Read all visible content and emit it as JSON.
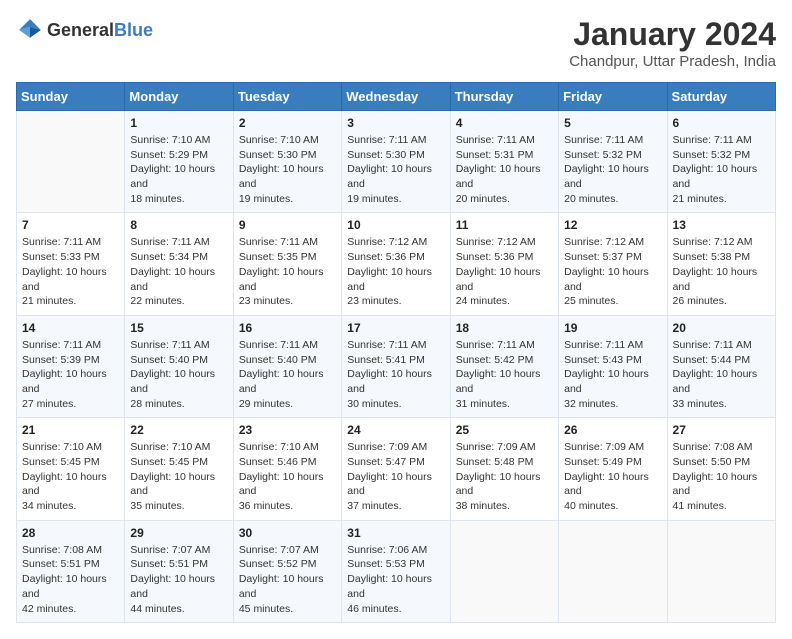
{
  "header": {
    "logo_general": "General",
    "logo_blue": "Blue",
    "title": "January 2024",
    "subtitle": "Chandpur, Uttar Pradesh, India"
  },
  "weekdays": [
    "Sunday",
    "Monday",
    "Tuesday",
    "Wednesday",
    "Thursday",
    "Friday",
    "Saturday"
  ],
  "weeks": [
    [
      {
        "day": "",
        "sunrise": "",
        "sunset": "",
        "daylight": ""
      },
      {
        "day": "1",
        "sunrise": "Sunrise: 7:10 AM",
        "sunset": "Sunset: 5:29 PM",
        "daylight": "Daylight: 10 hours and 18 minutes."
      },
      {
        "day": "2",
        "sunrise": "Sunrise: 7:10 AM",
        "sunset": "Sunset: 5:30 PM",
        "daylight": "Daylight: 10 hours and 19 minutes."
      },
      {
        "day": "3",
        "sunrise": "Sunrise: 7:11 AM",
        "sunset": "Sunset: 5:30 PM",
        "daylight": "Daylight: 10 hours and 19 minutes."
      },
      {
        "day": "4",
        "sunrise": "Sunrise: 7:11 AM",
        "sunset": "Sunset: 5:31 PM",
        "daylight": "Daylight: 10 hours and 20 minutes."
      },
      {
        "day": "5",
        "sunrise": "Sunrise: 7:11 AM",
        "sunset": "Sunset: 5:32 PM",
        "daylight": "Daylight: 10 hours and 20 minutes."
      },
      {
        "day": "6",
        "sunrise": "Sunrise: 7:11 AM",
        "sunset": "Sunset: 5:32 PM",
        "daylight": "Daylight: 10 hours and 21 minutes."
      }
    ],
    [
      {
        "day": "7",
        "sunrise": "Sunrise: 7:11 AM",
        "sunset": "Sunset: 5:33 PM",
        "daylight": "Daylight: 10 hours and 21 minutes."
      },
      {
        "day": "8",
        "sunrise": "Sunrise: 7:11 AM",
        "sunset": "Sunset: 5:34 PM",
        "daylight": "Daylight: 10 hours and 22 minutes."
      },
      {
        "day": "9",
        "sunrise": "Sunrise: 7:11 AM",
        "sunset": "Sunset: 5:35 PM",
        "daylight": "Daylight: 10 hours and 23 minutes."
      },
      {
        "day": "10",
        "sunrise": "Sunrise: 7:12 AM",
        "sunset": "Sunset: 5:36 PM",
        "daylight": "Daylight: 10 hours and 23 minutes."
      },
      {
        "day": "11",
        "sunrise": "Sunrise: 7:12 AM",
        "sunset": "Sunset: 5:36 PM",
        "daylight": "Daylight: 10 hours and 24 minutes."
      },
      {
        "day": "12",
        "sunrise": "Sunrise: 7:12 AM",
        "sunset": "Sunset: 5:37 PM",
        "daylight": "Daylight: 10 hours and 25 minutes."
      },
      {
        "day": "13",
        "sunrise": "Sunrise: 7:12 AM",
        "sunset": "Sunset: 5:38 PM",
        "daylight": "Daylight: 10 hours and 26 minutes."
      }
    ],
    [
      {
        "day": "14",
        "sunrise": "Sunrise: 7:11 AM",
        "sunset": "Sunset: 5:39 PM",
        "daylight": "Daylight: 10 hours and 27 minutes."
      },
      {
        "day": "15",
        "sunrise": "Sunrise: 7:11 AM",
        "sunset": "Sunset: 5:40 PM",
        "daylight": "Daylight: 10 hours and 28 minutes."
      },
      {
        "day": "16",
        "sunrise": "Sunrise: 7:11 AM",
        "sunset": "Sunset: 5:40 PM",
        "daylight": "Daylight: 10 hours and 29 minutes."
      },
      {
        "day": "17",
        "sunrise": "Sunrise: 7:11 AM",
        "sunset": "Sunset: 5:41 PM",
        "daylight": "Daylight: 10 hours and 30 minutes."
      },
      {
        "day": "18",
        "sunrise": "Sunrise: 7:11 AM",
        "sunset": "Sunset: 5:42 PM",
        "daylight": "Daylight: 10 hours and 31 minutes."
      },
      {
        "day": "19",
        "sunrise": "Sunrise: 7:11 AM",
        "sunset": "Sunset: 5:43 PM",
        "daylight": "Daylight: 10 hours and 32 minutes."
      },
      {
        "day": "20",
        "sunrise": "Sunrise: 7:11 AM",
        "sunset": "Sunset: 5:44 PM",
        "daylight": "Daylight: 10 hours and 33 minutes."
      }
    ],
    [
      {
        "day": "21",
        "sunrise": "Sunrise: 7:10 AM",
        "sunset": "Sunset: 5:45 PM",
        "daylight": "Daylight: 10 hours and 34 minutes."
      },
      {
        "day": "22",
        "sunrise": "Sunrise: 7:10 AM",
        "sunset": "Sunset: 5:45 PM",
        "daylight": "Daylight: 10 hours and 35 minutes."
      },
      {
        "day": "23",
        "sunrise": "Sunrise: 7:10 AM",
        "sunset": "Sunset: 5:46 PM",
        "daylight": "Daylight: 10 hours and 36 minutes."
      },
      {
        "day": "24",
        "sunrise": "Sunrise: 7:09 AM",
        "sunset": "Sunset: 5:47 PM",
        "daylight": "Daylight: 10 hours and 37 minutes."
      },
      {
        "day": "25",
        "sunrise": "Sunrise: 7:09 AM",
        "sunset": "Sunset: 5:48 PM",
        "daylight": "Daylight: 10 hours and 38 minutes."
      },
      {
        "day": "26",
        "sunrise": "Sunrise: 7:09 AM",
        "sunset": "Sunset: 5:49 PM",
        "daylight": "Daylight: 10 hours and 40 minutes."
      },
      {
        "day": "27",
        "sunrise": "Sunrise: 7:08 AM",
        "sunset": "Sunset: 5:50 PM",
        "daylight": "Daylight: 10 hours and 41 minutes."
      }
    ],
    [
      {
        "day": "28",
        "sunrise": "Sunrise: 7:08 AM",
        "sunset": "Sunset: 5:51 PM",
        "daylight": "Daylight: 10 hours and 42 minutes."
      },
      {
        "day": "29",
        "sunrise": "Sunrise: 7:07 AM",
        "sunset": "Sunset: 5:51 PM",
        "daylight": "Daylight: 10 hours and 44 minutes."
      },
      {
        "day": "30",
        "sunrise": "Sunrise: 7:07 AM",
        "sunset": "Sunset: 5:52 PM",
        "daylight": "Daylight: 10 hours and 45 minutes."
      },
      {
        "day": "31",
        "sunrise": "Sunrise: 7:06 AM",
        "sunset": "Sunset: 5:53 PM",
        "daylight": "Daylight: 10 hours and 46 minutes."
      },
      {
        "day": "",
        "sunrise": "",
        "sunset": "",
        "daylight": ""
      },
      {
        "day": "",
        "sunrise": "",
        "sunset": "",
        "daylight": ""
      },
      {
        "day": "",
        "sunrise": "",
        "sunset": "",
        "daylight": ""
      }
    ]
  ]
}
